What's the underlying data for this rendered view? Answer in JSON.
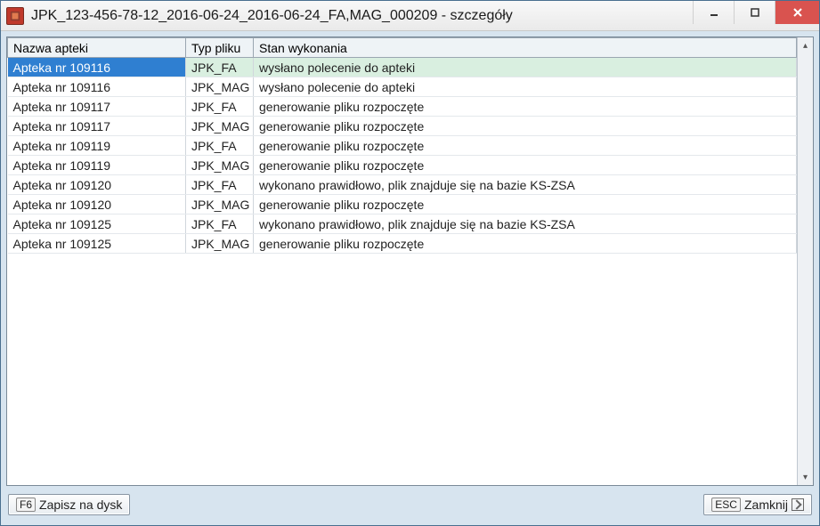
{
  "window": {
    "title": "JPK_123-456-78-12_2016-06-24_2016-06-24_FA,MAG_000209  - szczegóły"
  },
  "grid": {
    "headers": {
      "col_a": "Nazwa apteki",
      "col_b": "Typ pliku",
      "col_c": "Stan wykonania"
    },
    "rows": [
      {
        "a": "Apteka nr 109116",
        "b": "JPK_FA",
        "c": "wysłano polecenie do apteki",
        "selected": true
      },
      {
        "a": "Apteka nr 109116",
        "b": "JPK_MAG",
        "c": "wysłano polecenie do apteki"
      },
      {
        "a": "Apteka nr 109117",
        "b": "JPK_FA",
        "c": "generowanie pliku rozpoczęte"
      },
      {
        "a": "Apteka nr 109117",
        "b": "JPK_MAG",
        "c": "generowanie pliku rozpoczęte"
      },
      {
        "a": "Apteka nr 109119",
        "b": "JPK_FA",
        "c": "generowanie pliku rozpoczęte"
      },
      {
        "a": "Apteka nr 109119",
        "b": "JPK_MAG",
        "c": "generowanie pliku rozpoczęte"
      },
      {
        "a": "Apteka nr 109120",
        "b": "JPK_FA",
        "c": "wykonano prawidłowo, plik znajduje się na bazie KS-ZSA"
      },
      {
        "a": "Apteka nr 109120",
        "b": "JPK_MAG",
        "c": "generowanie pliku rozpoczęte"
      },
      {
        "a": "Apteka nr 109125",
        "b": "JPK_FA",
        "c": "wykonano prawidłowo, plik znajduje się na bazie KS-ZSA"
      },
      {
        "a": "Apteka nr 109125",
        "b": "JPK_MAG",
        "c": "generowanie pliku rozpoczęte"
      }
    ]
  },
  "footer": {
    "save": {
      "hotkey": "F6",
      "label": "Zapisz na dysk"
    },
    "close": {
      "hotkey": "ESC",
      "label": "Zamknij"
    }
  }
}
